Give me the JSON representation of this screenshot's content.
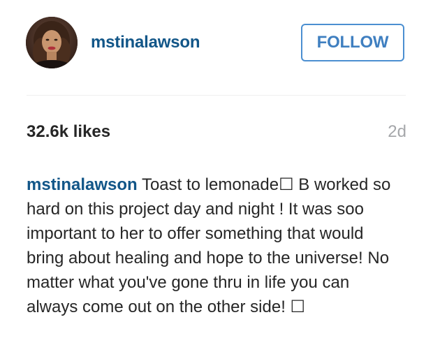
{
  "header": {
    "username": "mstinalawson",
    "follow_label": "FOLLOW"
  },
  "stats": {
    "likes_count": "32.6k",
    "likes_suffix": " likes",
    "time_ago": "2d"
  },
  "caption": {
    "username": "mstinalawson",
    "text": " Toast to lemonade☐ B worked so hard on this project day and night ! It was soo important to her to offer something that would bring about healing and hope to the universe! No matter what you've gone thru in life you can always come out on the other side! ☐"
  },
  "colors": {
    "username_blue": "#125688",
    "follow_border": "#4b8fd1",
    "timestamp_gray": "#a5a7aa",
    "text_dark": "#262626"
  }
}
